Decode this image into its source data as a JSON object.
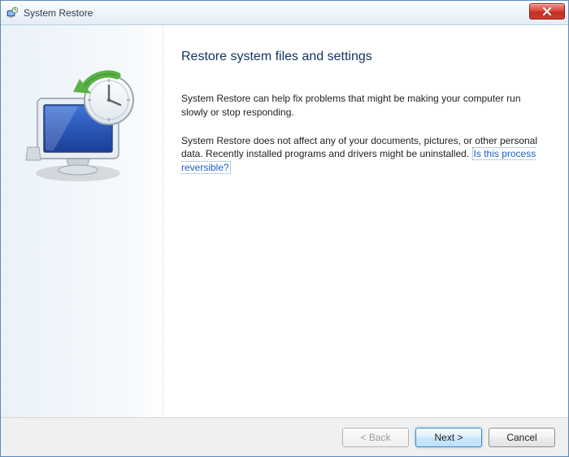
{
  "window": {
    "title": "System Restore"
  },
  "content": {
    "heading": "Restore system files and settings",
    "para1": "System Restore can help fix problems that might be making your computer run slowly or stop responding.",
    "para2_a": "System Restore does not affect any of your documents, pictures, or other personal data. Recently installed programs and drivers might be uninstalled. ",
    "help_link": "Is this process reversible?"
  },
  "footer": {
    "back": "< Back",
    "next": "Next >",
    "cancel": "Cancel"
  }
}
